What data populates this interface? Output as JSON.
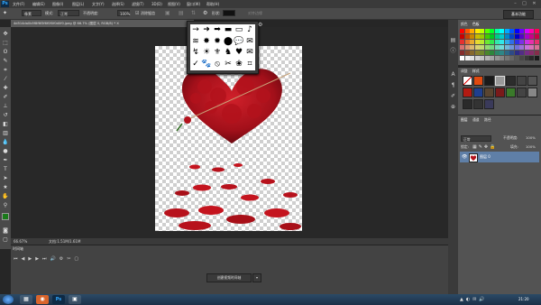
{
  "app": {
    "logo": "Ps"
  },
  "menu": [
    "文件(F)",
    "编辑(E)",
    "图像(I)",
    "图层(L)",
    "文字(Y)",
    "选择(S)",
    "滤镜(T)",
    "3D(D)",
    "视图(V)",
    "窗口(W)",
    "帮助(H)"
  ],
  "window_controls": [
    "–",
    "□",
    "✕"
  ],
  "options": {
    "tool_mode": "像素",
    "mode_label": "模式:",
    "mode_value": "正常",
    "opacity_label": "不透明度:",
    "opacity_value": "100%",
    "antialias_label": "消除锯齿",
    "shape_label": "形状:",
    "align_edges_label": "对齐边缘",
    "workspace": "基本功能"
  },
  "document": {
    "tab_title": "4d514da0b5f8f6f3f6f0f0f0d0f0.jpeg @ 66.7% (图层 0, RGB/8) *  ✕",
    "zoom": "66.67%",
    "doc_size": "文档:1.51M/1.61M"
  },
  "timeline": {
    "title": "时间轴",
    "create_button": "创建视频时间轴",
    "create_arrow": "▾"
  },
  "panels": {
    "swatch_tabs": [
      "颜色",
      "色板"
    ],
    "styles_tabs": [
      "调整",
      "样式"
    ],
    "layers_tabs": [
      "图层",
      "通道",
      "路径"
    ],
    "blend_mode": "正常",
    "opacity_label": "不透明度:",
    "opacity_value": "100%",
    "lock_label": "锁定:",
    "fill_label": "填充:",
    "fill_value": "100%",
    "layer_name": "图层 0"
  },
  "shapes": [
    "→",
    "➜",
    "➡",
    "▬",
    "▭",
    "♪",
    "≋",
    "✸",
    "✹",
    "⬤",
    "💬",
    "✉",
    "↯",
    "☀",
    "⚜",
    "♞",
    "♥",
    "✉",
    "✓",
    "🐾",
    "⦸",
    "✂",
    "❀",
    "⌗"
  ],
  "taskbar": {
    "clock": "21:20"
  },
  "colors": {
    "accent": "#31a8ff",
    "selected_layer": "#5f7fa7"
  }
}
